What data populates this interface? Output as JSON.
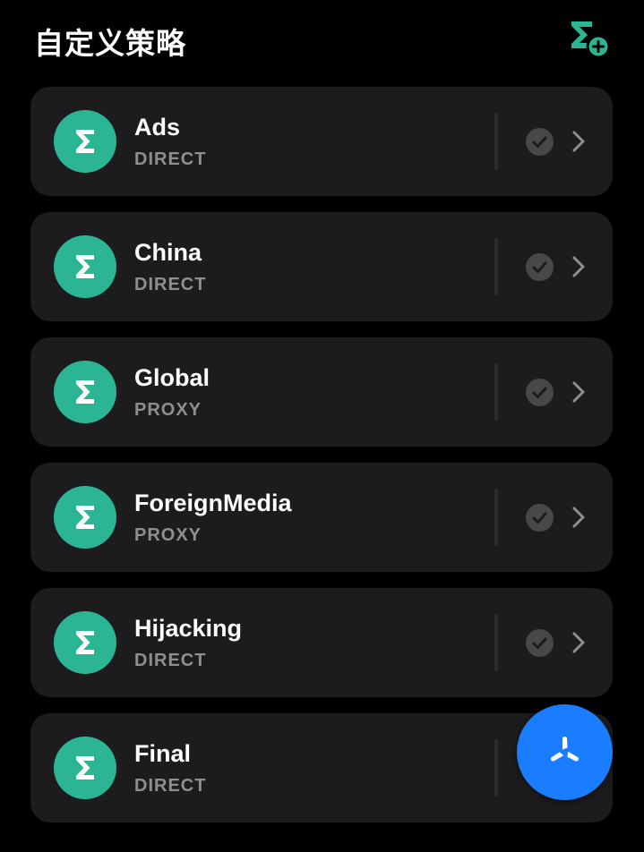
{
  "header": {
    "title": "自定义策略",
    "add_icon": "sigma-plus-icon"
  },
  "colors": {
    "background": "#000000",
    "card": "#1c1c1e",
    "accent_green": "#2bb594",
    "subtitle_gray": "#8e8e93",
    "fab_blue": "#1a7dff"
  },
  "policies": [
    {
      "name": "Ads",
      "policy": "DIRECT",
      "icon": "sigma-icon",
      "selected": true
    },
    {
      "name": "China",
      "policy": "DIRECT",
      "icon": "sigma-icon",
      "selected": true
    },
    {
      "name": "Global",
      "policy": "PROXY",
      "icon": "sigma-icon",
      "selected": true
    },
    {
      "name": "ForeignMedia",
      "policy": "PROXY",
      "icon": "sigma-icon",
      "selected": true
    },
    {
      "name": "Hijacking",
      "policy": "DIRECT",
      "icon": "sigma-icon",
      "selected": true
    },
    {
      "name": "Final",
      "policy": "DIRECT",
      "icon": "sigma-icon",
      "selected": true
    }
  ],
  "fab": {
    "icon": "pinwheel-icon"
  }
}
